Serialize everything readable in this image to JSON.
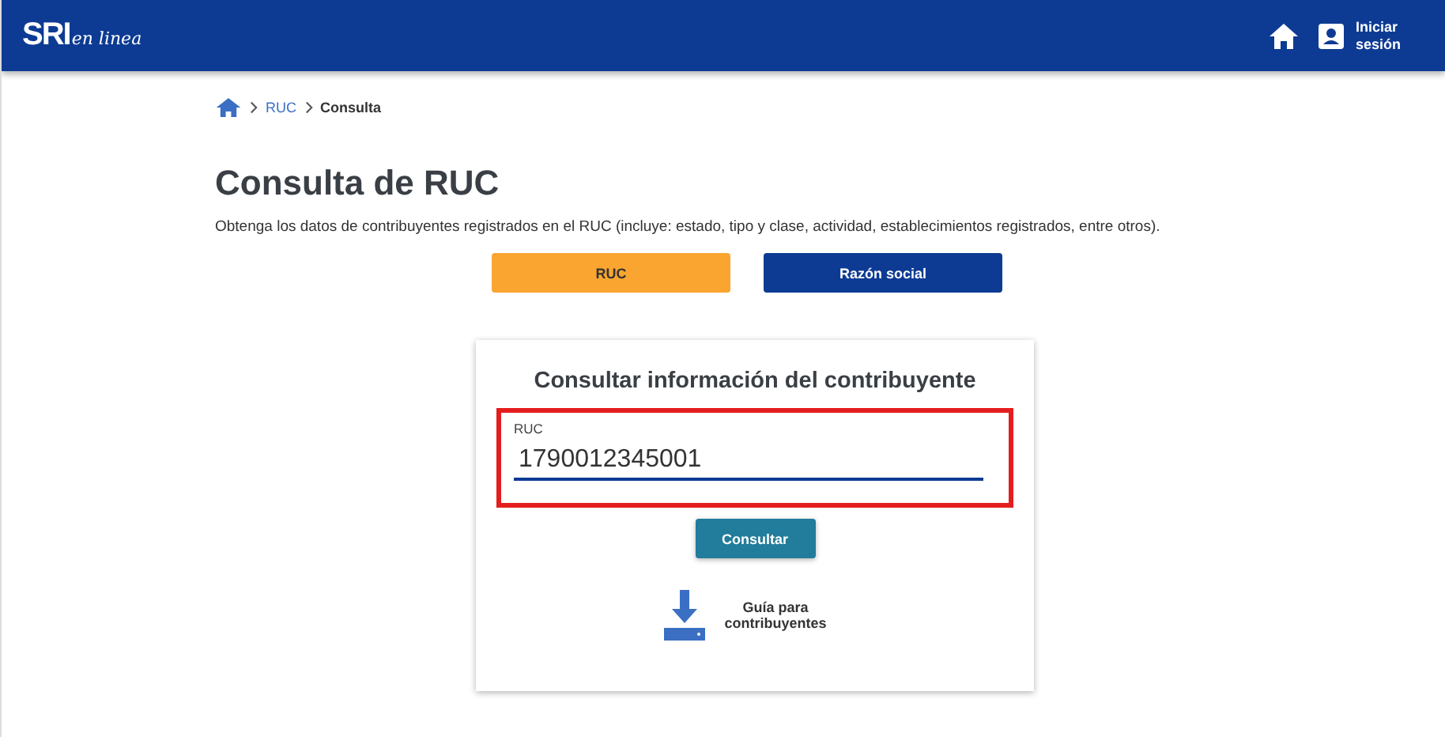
{
  "header": {
    "logo_main": "SRI",
    "logo_sub": "en linea",
    "login": {
      "line1": "Iniciar",
      "line2": "sesión"
    }
  },
  "breadcrumb": [
    "RUC",
    "Consulta"
  ],
  "title": "Consulta de RUC",
  "description": "Obtenga los datos de contribuyentes registrados en el RUC (incluye: estado, tipo y clase, actividad, establecimientos registrados, entre otros).",
  "tabs": [
    {
      "label": "RUC",
      "selected": true
    },
    {
      "label": "Razón social",
      "selected": false
    }
  ],
  "card": {
    "title": "Consultar información del contribuyente",
    "field": {
      "label": "RUC",
      "value": "1790012345001",
      "highlighted": true
    },
    "button": "Consultar",
    "guide": {
      "line1": "Guía para",
      "line2": "contribuyentes"
    }
  }
}
